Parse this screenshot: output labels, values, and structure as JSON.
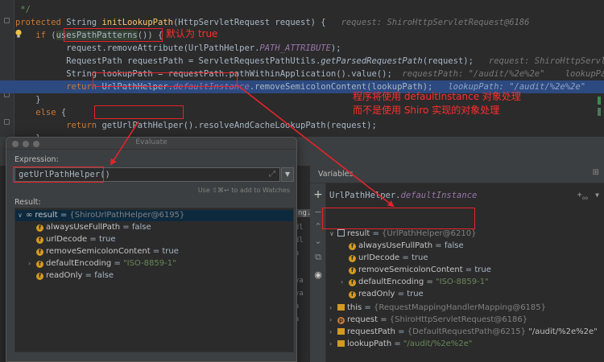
{
  "editor": {
    "lines": {
      "l0": "    */",
      "l1_kw": "protected",
      "l1_type": " String ",
      "l1_fn": "initLookupPath",
      "l1_rest": "(HttpServletRequest request) {",
      "l1_hint": "request: ShiroHttpServletRequest@6186",
      "l2_kw": "if",
      "l2_call": "usesPathPatterns",
      "l2_rest": "()) {",
      "l3_a": "request.removeAttribute(UrlPathHelper.",
      "l3_const": "PATH_ATTRIBUTE",
      "l3_b": ");",
      "l4_a": "RequestPath requestPath = ServletRequestPathUtils.",
      "l4_static": "getParsedRequestPath",
      "l4_b": "(request);",
      "l4_hint": "request: ShiroHttpServletRequest@6",
      "l5_a": "String lookupPath = requestPath.pathWithinApplication().value();",
      "l5_hint": "requestPath: \"/audit/%2e%2e\"    lookupPath: \"/audit/",
      "l6_kw": "return",
      "l6_a": " UrlPathHelper.",
      "l6_inst": "defaultInstance",
      "l6_b": ".removeSemicolonContent(lookupPath);",
      "l6_hint": "lookupPath: \"/audit/%2e%2e\"",
      "l7": "}",
      "l8_kw": "else",
      "l8_b": " {",
      "l9_kw": "return",
      "l9_call": "getUrlPathHelper()",
      "l9_b": ".resolveAndCacheLookupPath(request);",
      "l10": "}",
      "l11": "}"
    },
    "annotation_true": "默认为 true",
    "annotation_main_1": "程序将使用 defaultInstance 对象处理",
    "annotation_main_2": "而不是使用 Shiro 实现的对象处理"
  },
  "evaluate": {
    "title": "Evaluate",
    "expression_label": "Expression:",
    "expression_value": "getUrlPathHelper()",
    "watch_hint": "Use ⇧⌘↩ to add to Watches",
    "result_label": "Result:",
    "result_root": "result",
    "result_root_value": "{ShiroUrlPathHelper@6195}",
    "fields": [
      {
        "name": "alwaysUseFullPath",
        "value": "false"
      },
      {
        "name": "urlDecode",
        "value": "true"
      },
      {
        "name": "removeSemicolonContent",
        "value": "true"
      },
      {
        "name": "defaultEncoding",
        "value": "\"ISO-8859-1\""
      },
      {
        "name": "readOnly",
        "value": "false"
      }
    ]
  },
  "variables": {
    "header": "Variables",
    "watch_expression_a": "UrlPathHelper.",
    "watch_expression_b": "defaultInstance",
    "result_root": "result",
    "result_root_value": "{UrlPathHelper@6210}",
    "fields": [
      {
        "name": "alwaysUseFullPath",
        "value": "false"
      },
      {
        "name": "urlDecode",
        "value": "true"
      },
      {
        "name": "removeSemicolonContent",
        "value": "true"
      },
      {
        "name": "defaultEncoding",
        "value": "\"ISO-8859-1\""
      },
      {
        "name": "readOnly",
        "value": "true"
      }
    ],
    "locals": [
      {
        "name": "this",
        "value": "{RequestMappingHandlerMapping@6185}",
        "extra": ""
      },
      {
        "name": "request",
        "value": "{ShiroHttpServletRequest@6186}",
        "extra": ""
      },
      {
        "name": "requestPath",
        "value": "{DefaultRequestPath@6215}",
        "extra": "\"/audit/%2e%2e\""
      },
      {
        "name": "lookupPath",
        "value": "\"/audit/%2e%2e\"",
        "extra": ""
      }
    ]
  },
  "frames_partial": [
    "ng.",
    "andl",
    "andl",
    "ava",
    "java",
    "java",
    "ava",
    "ava",
    "va"
  ],
  "colors": {
    "annotation_red": "#e5242b",
    "editor_bg": "#2b2b2b",
    "panel_bg": "#3c3f41",
    "highlight_line": "#2d4a80"
  }
}
